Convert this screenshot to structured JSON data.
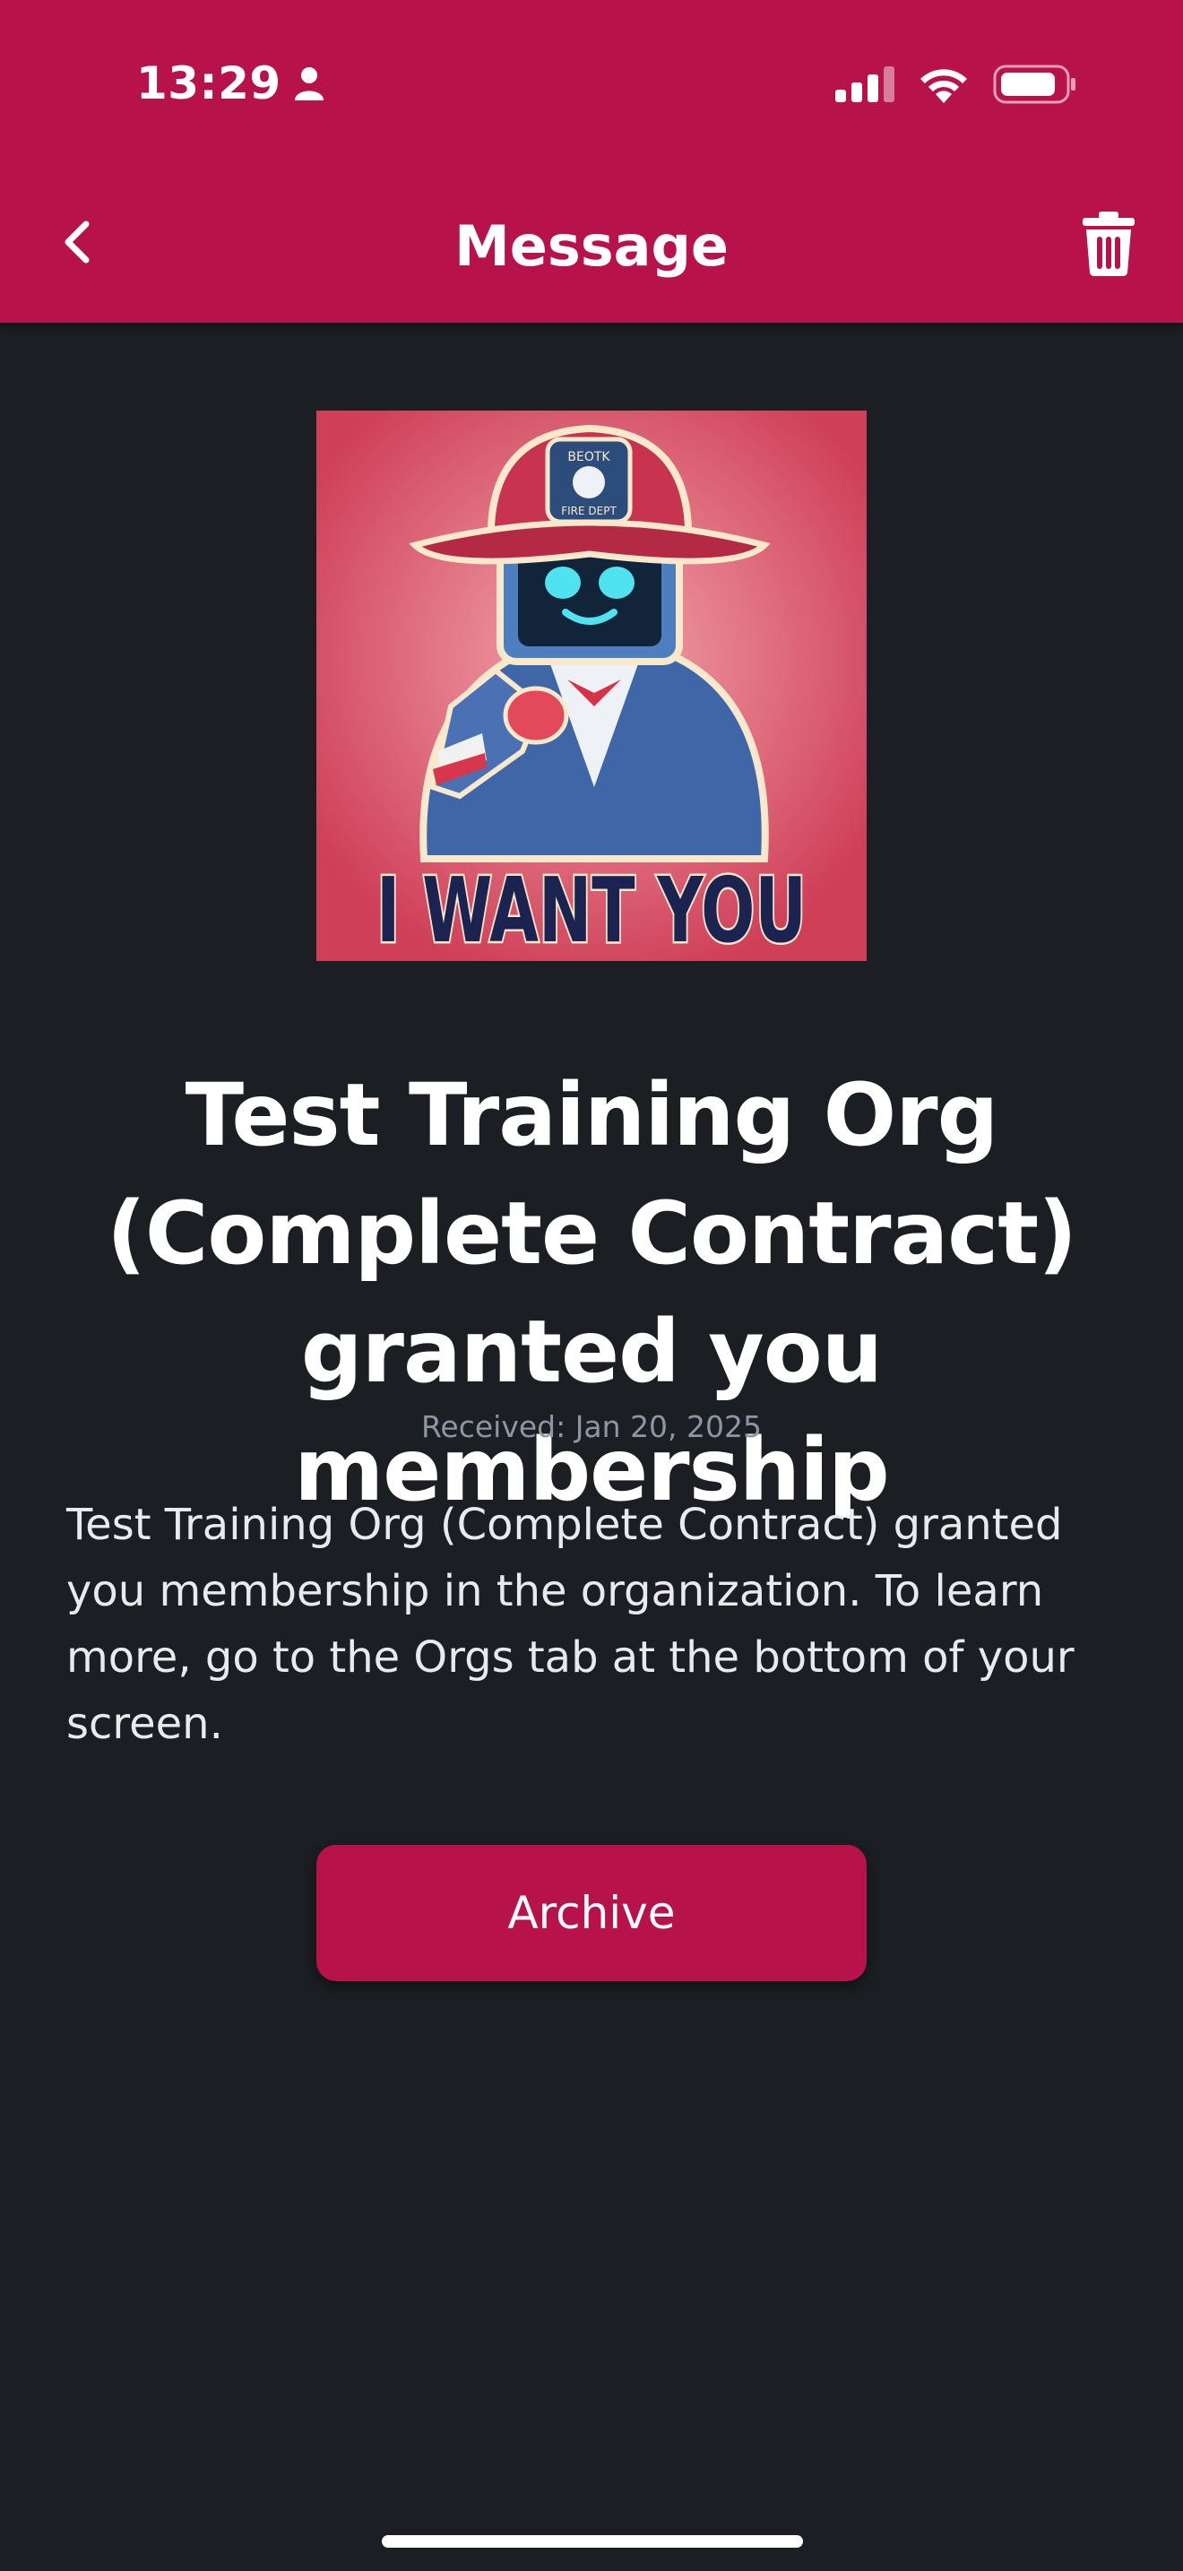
{
  "status_bar": {
    "time": "13:29"
  },
  "nav": {
    "title": "Message"
  },
  "message": {
    "image_caption": "I WANT YOU",
    "helmet_text_top": "BEOTK",
    "helmet_text_bottom": "FIRE DEPT",
    "title": "Test Training Org (Complete Contract) granted you membership",
    "received": "Received: Jan 20, 2025",
    "body": "Test Training Org (Complete Contract) granted you membership in the organization. To learn more, go to the Orgs tab at the bottom of your screen."
  },
  "actions": {
    "archive_label": "Archive"
  },
  "colors": {
    "accent": "#b8124a",
    "background": "#1b1e22"
  }
}
